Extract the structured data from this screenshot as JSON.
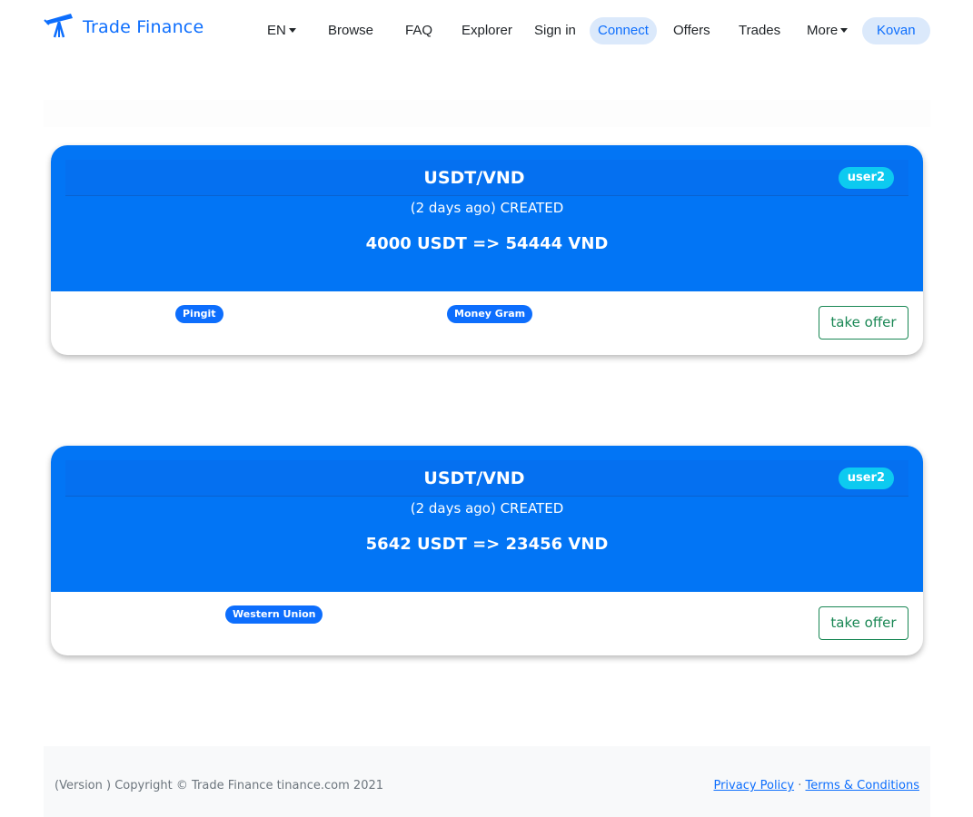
{
  "brand": {
    "name": "Trade Finance",
    "icon": "telescope-logo-icon"
  },
  "nav": {
    "language": "EN",
    "browse": "Browse",
    "faq": "FAQ",
    "explorer": "Explorer",
    "sign_in": "Sign in",
    "connect": "Connect",
    "offers": "Offers",
    "trades": "Trades",
    "more": "More",
    "network": "Kovan"
  },
  "offers": [
    {
      "pair": "USDT/VND",
      "user": "user2",
      "status": "(2 days ago) CREATED",
      "amount": "4000 USDT => 54444 VND",
      "methods": [
        "Pingit",
        "Money Gram"
      ],
      "action": "take offer"
    },
    {
      "pair": "USDT/VND",
      "user": "user2",
      "status": "(2 days ago) CREATED",
      "amount": "5642 USDT => 23456 VND",
      "methods": [
        "Western Union"
      ],
      "action": "take offer"
    }
  ],
  "footer": {
    "copyright": "(Version ) Copyright © Trade Finance tinance.com 2021",
    "privacy": "Privacy Policy",
    "separator": "·",
    "terms": "Terms & Conditions"
  },
  "colors": {
    "primary": "#0d6efd",
    "card_background": "#0275f5",
    "info_badge": "#0dcaf0",
    "success": "#198754",
    "footer_background": "#f8f9fa"
  }
}
